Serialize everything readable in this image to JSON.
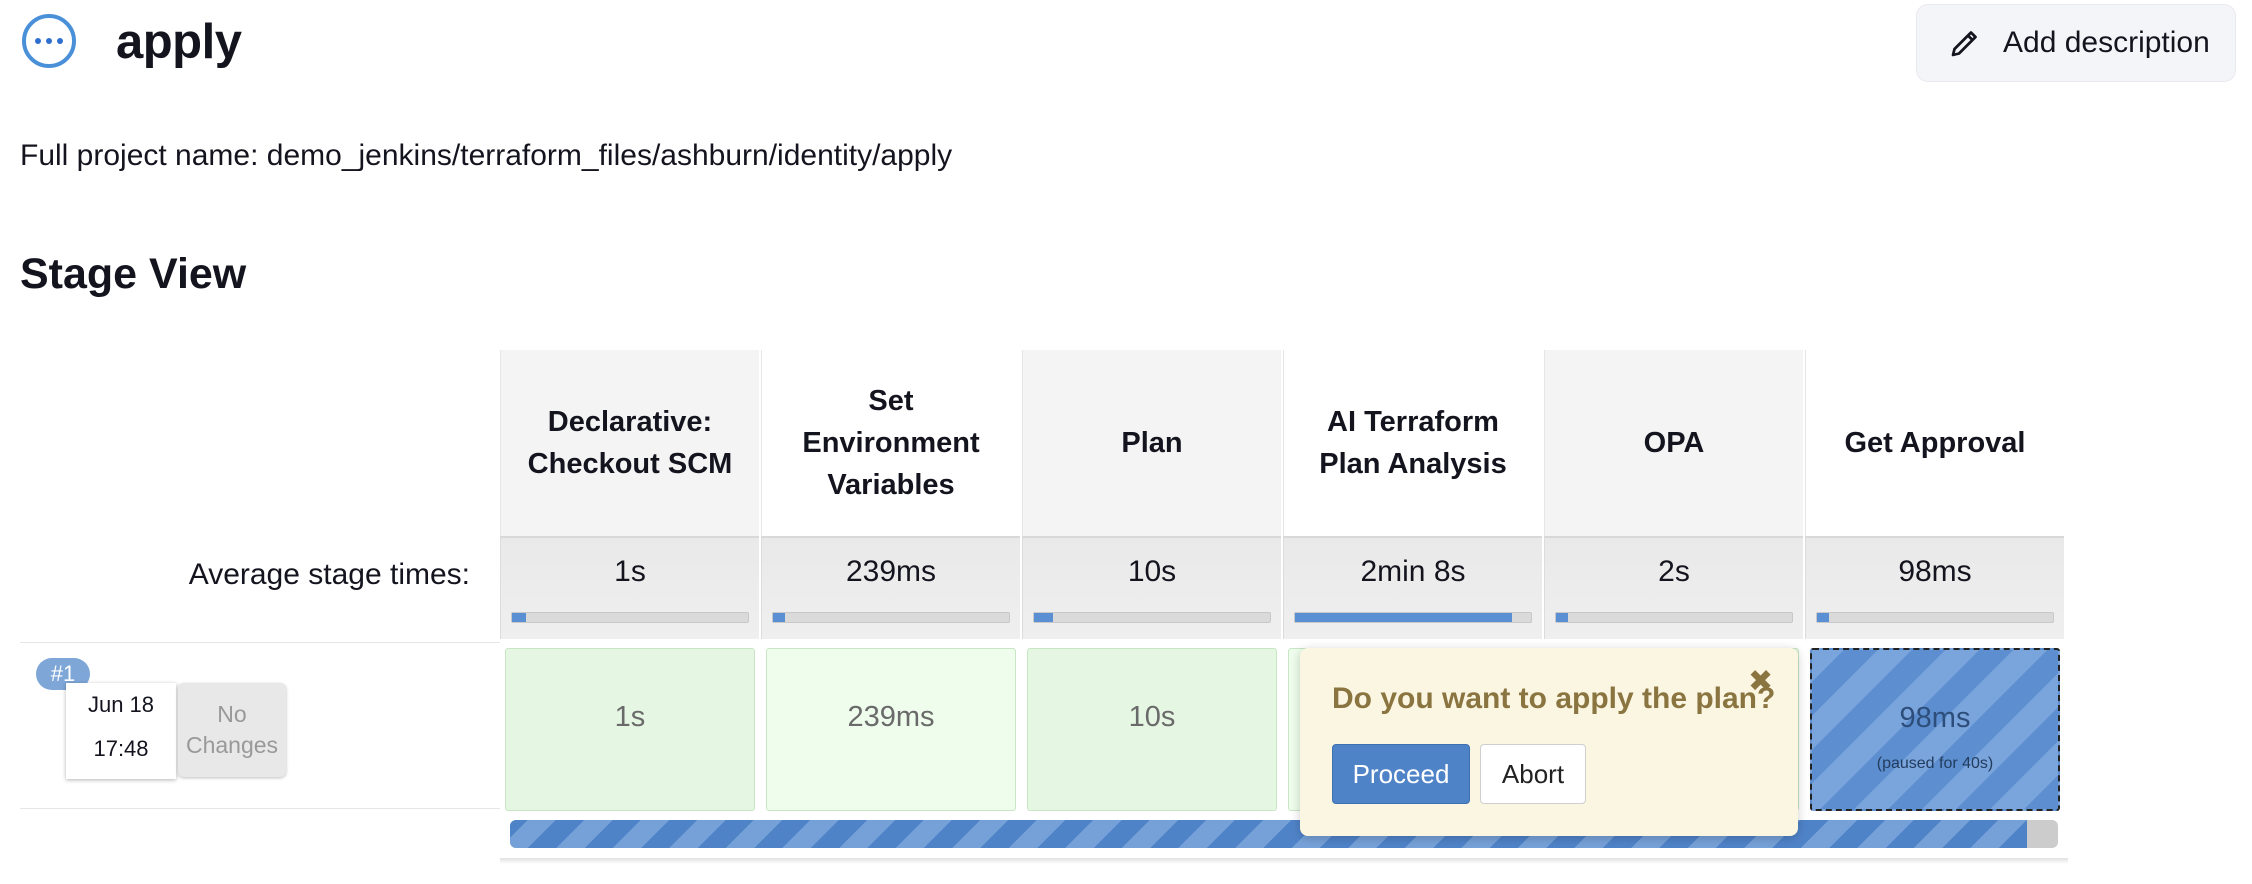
{
  "job": {
    "title": "apply",
    "status": "in-progress"
  },
  "header": {
    "add_description_label": "Add description",
    "add_description_icon": "pencil-icon"
  },
  "project": {
    "full_name_label": "Full project name:",
    "full_name_value": "demo_jenkins/terraform_files/ashburn/identity/apply"
  },
  "stage_view": {
    "heading": "Stage View",
    "average_label": "Average stage times:",
    "stages": [
      {
        "name": "Declarative: Checkout SCM",
        "average": "1s",
        "bar_fraction": 0.06
      },
      {
        "name": "Set Environment Variables",
        "average": "239ms",
        "bar_fraction": 0.05
      },
      {
        "name": "Plan",
        "average": "10s",
        "bar_fraction": 0.08
      },
      {
        "name": "AI Terraform Plan Analysis",
        "average": "2min 8s",
        "bar_fraction": 0.92
      },
      {
        "name": "OPA",
        "average": "2s",
        "bar_fraction": 0.05
      },
      {
        "name": "Get Approval",
        "average": "98ms",
        "bar_fraction": 0.05
      }
    ],
    "build": {
      "number": "#1",
      "date": "Jun 18",
      "time": "17:48",
      "changes": "No Changes",
      "stage_times": [
        "1s",
        "239ms",
        "10s",
        "",
        "",
        "98ms"
      ],
      "paused_text": "(paused for 40s)",
      "progress_fraction": 0.98
    }
  },
  "approval": {
    "question": "Do you want to apply the plan?",
    "proceed_label": "Proceed",
    "abort_label": "Abort"
  },
  "colors": {
    "accent": "#4f83c8",
    "success_bg": "#e5f6e3",
    "popover_bg": "#fbf6e2"
  }
}
